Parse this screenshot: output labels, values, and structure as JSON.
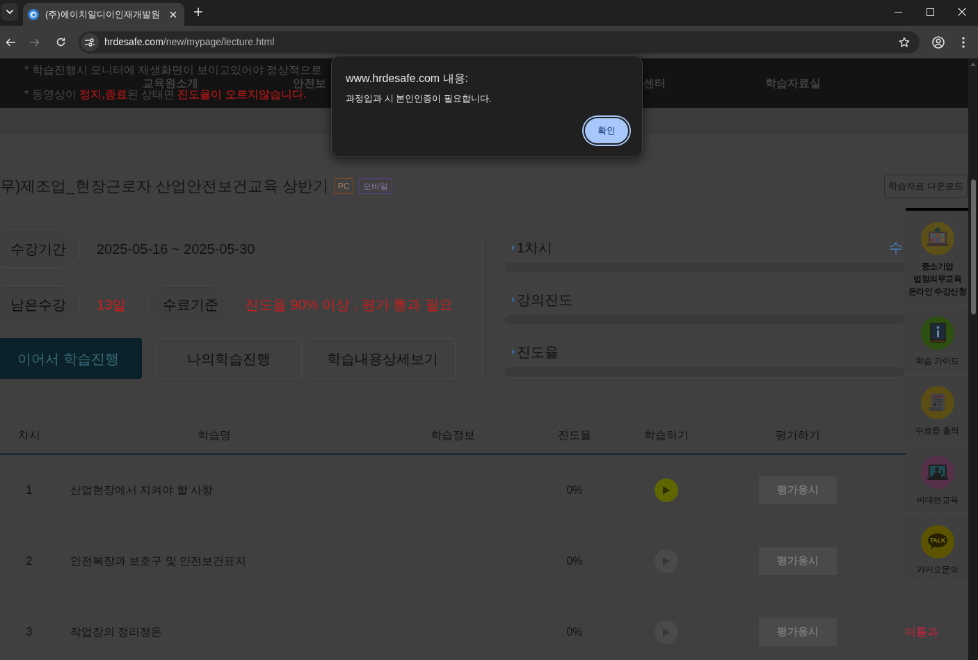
{
  "browser": {
    "tab": {
      "title": "(주)에이치알디이인재개발원"
    },
    "url": {
      "host": "hrdesafe.com",
      "path": "/new/mypage/lecture.html"
    },
    "forward_disabled": true
  },
  "header": {
    "notices": [
      "* 학습진행시 모니터에 재생화면이 보이고있어야 정상적으로",
      "* 동영상이 **정지,종료**된 상태면 **진도율이 오르지않습니다.**"
    ],
    "nav": [
      "교육원소개",
      "안전보",
      "센터",
      "학습자료실"
    ]
  },
  "course": {
    "title": "무)제조업_현장근로자 산업안전보건교육 상반기",
    "badges": [
      {
        "label": "PC",
        "color": "#8a461c"
      },
      {
        "label": "모바일",
        "color": "#5a3c8c"
      }
    ],
    "download_button": "학습자료 다운로드"
  },
  "info": {
    "rows": [
      [
        {
          "label": "수강기간",
          "value": "2025-05-16 ~ 2025-05-30",
          "highlight": false
        }
      ],
      [
        {
          "label": "남은수강",
          "value": "13일",
          "highlight": true
        },
        {
          "label": "수료기준",
          "value": "진도율 90% 이상 , 평가 통과 필요",
          "highlight": true
        }
      ]
    ],
    "actions": [
      {
        "label": "이어서 학습진행",
        "primary": true
      },
      {
        "label": "나의학습진행",
        "primary": false
      },
      {
        "label": "학습내용상세보기",
        "primary": false
      }
    ]
  },
  "progress": [
    {
      "label": "1차시",
      "note": "수",
      "level": 0
    },
    {
      "label": "강의진도",
      "level": 0
    },
    {
      "label": "진도율",
      "level": 0
    }
  ],
  "table": {
    "columns": [
      "차시",
      "학습명",
      "학습정보",
      "진도율",
      "학습하기",
      "평가하기"
    ],
    "rows": [
      {
        "number": "1",
        "title": "산업현장에서 지켜야 할 사항",
        "progress": "0%",
        "play_active": true,
        "exam_button": "평가응시",
        "exam_disabled": true
      },
      {
        "number": "2",
        "title": "안전복장과 보호구 및 안전보건표지",
        "progress": "0%",
        "play_active": false,
        "exam_button": "평가응시",
        "exam_disabled": true
      },
      {
        "number": "3",
        "title": "작업장의 정리정돈",
        "progress": "0%",
        "play_active": false,
        "exam_button": "평가응시",
        "exam_disabled": true,
        "result": "미통과"
      }
    ]
  },
  "quick_menu": [
    {
      "label": "중소기업\n법정의무교육\n온라인 수강신청",
      "emphasized": true
    },
    {
      "label": "학습 가이드",
      "emphasized": false
    },
    {
      "label": "수료증 출력",
      "emphasized": false
    },
    {
      "label": "비대면교육",
      "emphasized": false
    },
    {
      "label": "카카오문의",
      "emphasized": false,
      "logo_text": "TALK"
    }
  ],
  "dialog": {
    "title": "www.hrdesafe.com 내용:",
    "message": "과정입과 시 본인인증이 필요합니다.",
    "button": "확인"
  }
}
